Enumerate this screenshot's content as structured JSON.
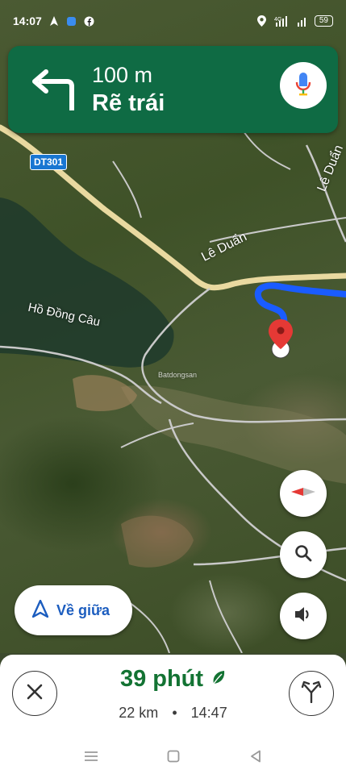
{
  "status_bar": {
    "time": "14:07",
    "network": "4G",
    "battery": "59"
  },
  "navigation": {
    "distance": "100 m",
    "instruction": "Rẽ trái",
    "turn_icon": "turn-left-icon",
    "colors": {
      "banner": "#0f6b44",
      "route": "#1a5cff",
      "eta": "#137333"
    }
  },
  "map": {
    "route_shield": "DT301",
    "labels": {
      "road_main": "Lê Duẩn",
      "road_side": "Lê Duẩn",
      "lake": "Hồ Đồng Câu",
      "watermark": "Batdongsan"
    }
  },
  "controls": {
    "recenter_label": "Về giữa",
    "compass_icon": "compass-icon",
    "search_icon": "search-icon",
    "sound_icon": "volume-icon"
  },
  "trip": {
    "duration": "39 phút",
    "distance": "22 km",
    "separator": "•",
    "arrival_time": "14:47"
  }
}
